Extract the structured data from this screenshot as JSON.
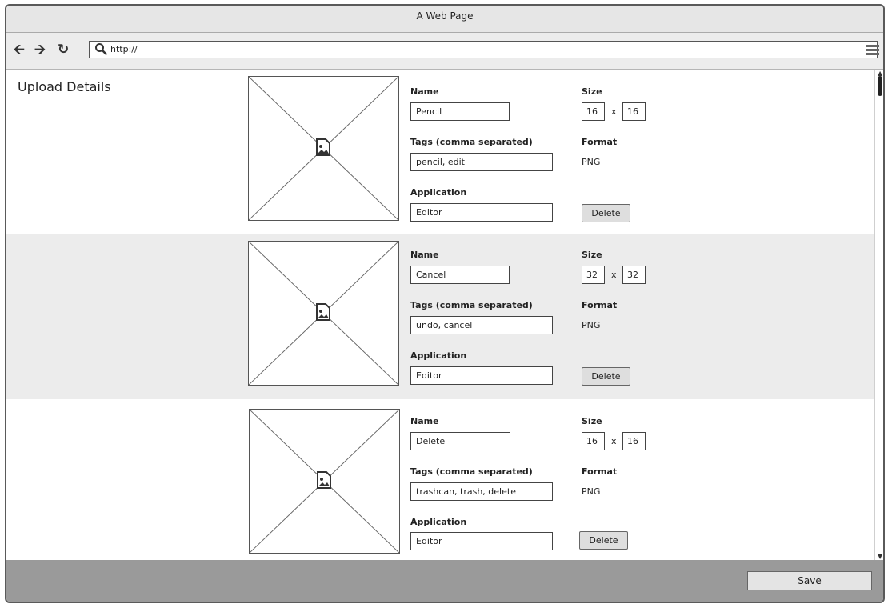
{
  "window": {
    "title": "A Web Page"
  },
  "toolbar": {
    "url": "http://"
  },
  "page": {
    "title": "Upload Details"
  },
  "labels": {
    "name": "Name",
    "size": "Size",
    "tags": "Tags (comma separated)",
    "format": "Format",
    "application": "Application",
    "times": "x",
    "delete": "Delete"
  },
  "items": [
    {
      "name": "Pencil",
      "width": "16",
      "height": "16",
      "tags": "pencil, edit",
      "format": "PNG",
      "application": "Editor"
    },
    {
      "name": "Cancel",
      "width": "32",
      "height": "32",
      "tags": "undo, cancel",
      "format": "PNG",
      "application": "Editor"
    },
    {
      "name": "Delete",
      "width": "16",
      "height": "16",
      "tags": "trashcan, trash, delete",
      "format": "PNG",
      "application": "Editor"
    }
  ],
  "footer": {
    "save_label": "Save"
  },
  "icons": {
    "back": "back-arrow-icon",
    "forward": "forward-arrow-icon",
    "reload": "reload-icon",
    "search": "search-icon",
    "menu": "hamburger-menu-icon",
    "image": "image-placeholder-icon"
  }
}
